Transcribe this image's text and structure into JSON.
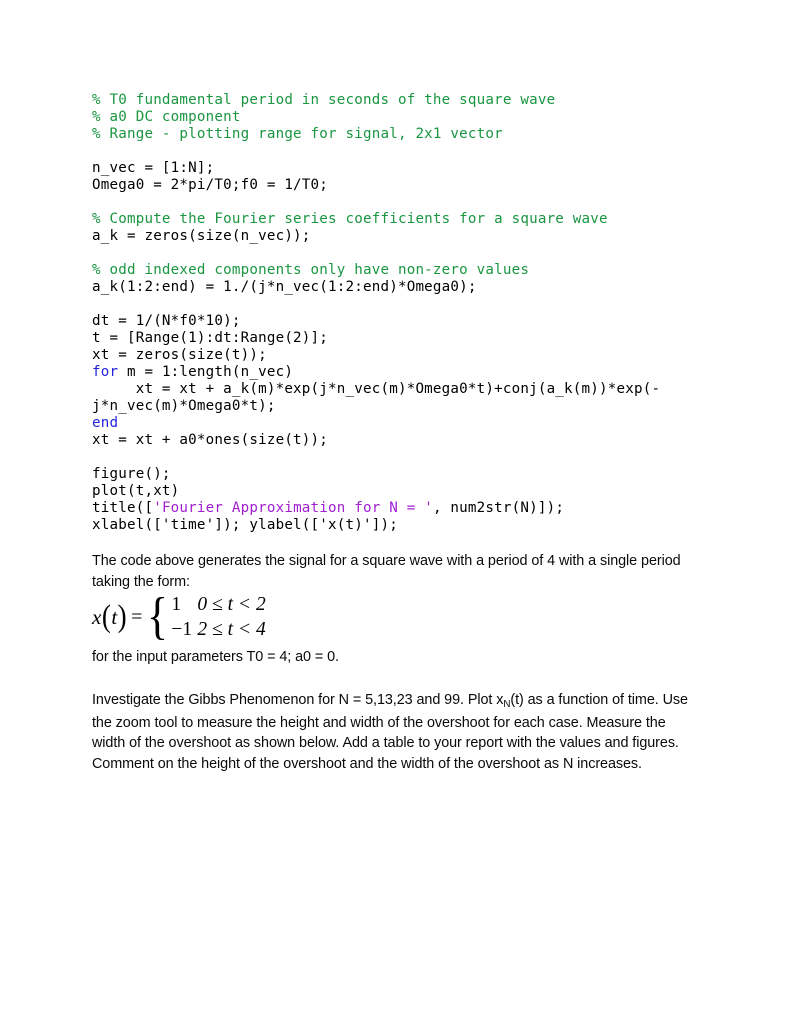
{
  "code": {
    "language": "MATLAB",
    "lines": [
      {
        "type": "comment",
        "text": "% T0 fundamental period in seconds of the square wave"
      },
      {
        "type": "comment",
        "text": "% a0 DC component"
      },
      {
        "type": "comment",
        "text": "% Range - plotting range for signal, 2x1 vector"
      },
      {
        "type": "blank",
        "text": ""
      },
      {
        "type": "plain",
        "text": "n_vec = [1:N];"
      },
      {
        "type": "plain",
        "text": "Omega0 = 2*pi/T0;f0 = 1/T0;"
      },
      {
        "type": "blank",
        "text": ""
      },
      {
        "type": "comment",
        "text": "% Compute the Fourier series coefficients for a square wave"
      },
      {
        "type": "plain",
        "text": "a_k = zeros(size(n_vec));"
      },
      {
        "type": "blank",
        "text": ""
      },
      {
        "type": "comment",
        "text": "% odd indexed components only have non-zero values"
      },
      {
        "type": "plain",
        "text": "a_k(1:2:end) = 1./(j*n_vec(1:2:end)*Omega0);"
      },
      {
        "type": "blank",
        "text": ""
      },
      {
        "type": "plain",
        "text": "dt = 1/(N*f0*10);"
      },
      {
        "type": "plain",
        "text": "t = [Range(1):dt:Range(2)];"
      },
      {
        "type": "plain",
        "text": "xt = zeros(size(t));"
      },
      {
        "type": "keyword-line",
        "keyword": "for",
        "rest": " m = 1:length(n_vec)"
      },
      {
        "type": "plain",
        "text": "     xt = xt + a_k(m)*exp(j*n_vec(m)*Omega0*t)+conj(a_k(m))*exp(-"
      },
      {
        "type": "plain",
        "text": "j*n_vec(m)*Omega0*t);"
      },
      {
        "type": "keyword-line",
        "keyword": "end",
        "rest": ""
      },
      {
        "type": "plain",
        "text": "xt = xt + a0*ones(size(t));"
      },
      {
        "type": "blank",
        "text": ""
      },
      {
        "type": "plain",
        "text": "figure();"
      },
      {
        "type": "plain",
        "text": "plot(t,xt)"
      },
      {
        "type": "title-line",
        "prefix": "title([",
        "string": "'Fourier Approximation for N = '",
        "suffix": ", num2str(N)]);"
      },
      {
        "type": "plain",
        "text": "xlabel(['time']); ylabel(['x(t)']);"
      }
    ]
  },
  "prose": {
    "para_above": "The code above generates the signal for a square wave with a period of 4 with a single period taking the form:",
    "para_params": "for the input parameters T0 = 4; a0 = 0.",
    "para_investigate_part1": "Investigate the Gibbs Phenomenon for N = 5,13,23 and 99. Plot x",
    "para_investigate_sub": "N",
    "para_investigate_part2": "(t) as a function of time. Use the zoom tool to measure the height and width of the overshoot for each case. Measure the width of the overshoot as shown below. Add a table to your report with the values and figures. Comment on the height of the overshoot and the width of the overshoot as N increases."
  },
  "equation": {
    "lhs_var": "x",
    "lhs_open": "(",
    "lhs_arg": "t",
    "lhs_close": ")",
    "equals": "=",
    "brace": "{",
    "case1_value": "1",
    "case1_condition": "0 ≤ t < 2",
    "case2_value": "−1",
    "case2_condition": "2 ≤ t < 4"
  },
  "colors": {
    "comment_green": "#1a9641",
    "keyword_blue": "#2222dd",
    "string_magenta": "#a020d0",
    "text_black": "#000000",
    "page_background": "#ffffff"
  }
}
